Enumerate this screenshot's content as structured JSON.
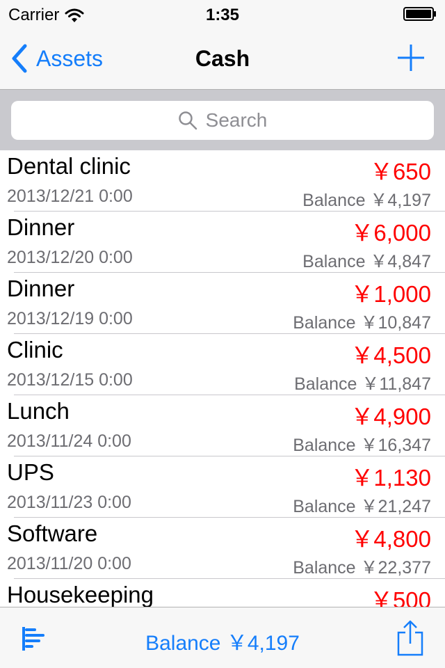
{
  "status_bar": {
    "carrier": "Carrier",
    "time": "1:35"
  },
  "nav": {
    "back_label": "Assets",
    "title": "Cash"
  },
  "search": {
    "placeholder": "Search"
  },
  "transactions": [
    {
      "title": "Dental clinic",
      "amount": "￥650",
      "date": "2013/12/21 0:00",
      "balance": "Balance ￥4,197"
    },
    {
      "title": "Dinner",
      "amount": "￥6,000",
      "date": "2013/12/20 0:00",
      "balance": "Balance ￥4,847"
    },
    {
      "title": "Dinner",
      "amount": "￥1,000",
      "date": "2013/12/19 0:00",
      "balance": "Balance ￥10,847"
    },
    {
      "title": "Clinic",
      "amount": "￥4,500",
      "date": "2013/12/15 0:00",
      "balance": "Balance ￥11,847"
    },
    {
      "title": "Lunch",
      "amount": "￥4,900",
      "date": "2013/11/24 0:00",
      "balance": "Balance ￥16,347"
    },
    {
      "title": "UPS",
      "amount": "￥1,130",
      "date": "2013/11/23 0:00",
      "balance": "Balance ￥21,247"
    },
    {
      "title": "Software",
      "amount": "￥4,800",
      "date": "2013/11/20 0:00",
      "balance": "Balance ￥22,377"
    },
    {
      "title": "Housekeeping",
      "amount": "￥500",
      "date": "",
      "balance": ""
    }
  ],
  "toolbar": {
    "balance": "Balance ￥4,197"
  },
  "colors": {
    "accent": "#157efb",
    "expense": "#ff0000",
    "secondary_text": "#6d6d72"
  },
  "icons": {
    "wifi": "wifi-icon",
    "battery": "battery-icon",
    "back": "chevron-left-icon",
    "add": "plus-icon",
    "search": "search-icon",
    "chart": "bar-chart-icon",
    "share": "share-icon"
  }
}
